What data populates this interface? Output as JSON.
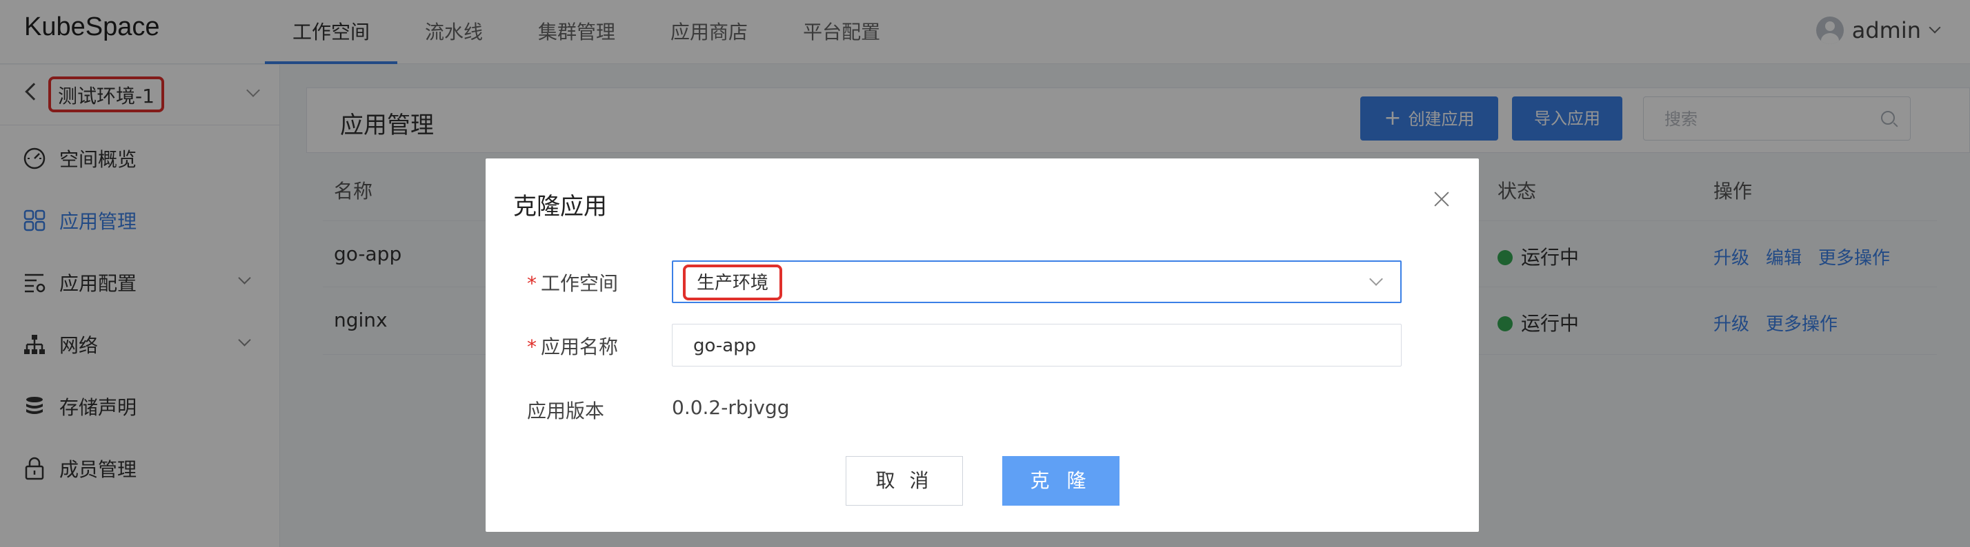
{
  "header": {
    "logo": "KubeSpace",
    "nav": [
      "工作空间",
      "流水线",
      "集群管理",
      "应用商店",
      "平台配置"
    ],
    "user": "admin"
  },
  "sidebar": {
    "workspace": "测试环境-1",
    "items": [
      {
        "label": "空间概览",
        "icon": "dashboard-icon"
      },
      {
        "label": "应用管理",
        "icon": "apps-grid-icon"
      },
      {
        "label": "应用配置",
        "icon": "config-icon"
      },
      {
        "label": "网络",
        "icon": "network-icon"
      },
      {
        "label": "存储声明",
        "icon": "storage-icon"
      },
      {
        "label": "成员管理",
        "icon": "lock-icon"
      }
    ]
  },
  "main": {
    "title": "应用管理",
    "create_label": "创建应用",
    "import_label": "导入应用",
    "search_placeholder": "搜索",
    "columns": [
      "名称",
      "状态",
      "操作"
    ],
    "rows": [
      {
        "name": "go-app",
        "status": "运行中",
        "actions": [
          "升级",
          "编辑",
          "更多操作"
        ]
      },
      {
        "name": "nginx",
        "status": "运行中",
        "actions": [
          "升级",
          "更多操作"
        ]
      }
    ]
  },
  "modal": {
    "title": "克隆应用",
    "workspace_label": "工作空间",
    "workspace_value": "生产环境",
    "name_label": "应用名称",
    "name_value": "go-app",
    "version_label": "应用版本",
    "version_value": "0.0.2-rbjvgg",
    "cancel_label": "取 消",
    "clone_label": "克 隆"
  },
  "colors": {
    "primary": "#3b80e6",
    "highlight": "#e0302b",
    "running": "#34a853"
  }
}
